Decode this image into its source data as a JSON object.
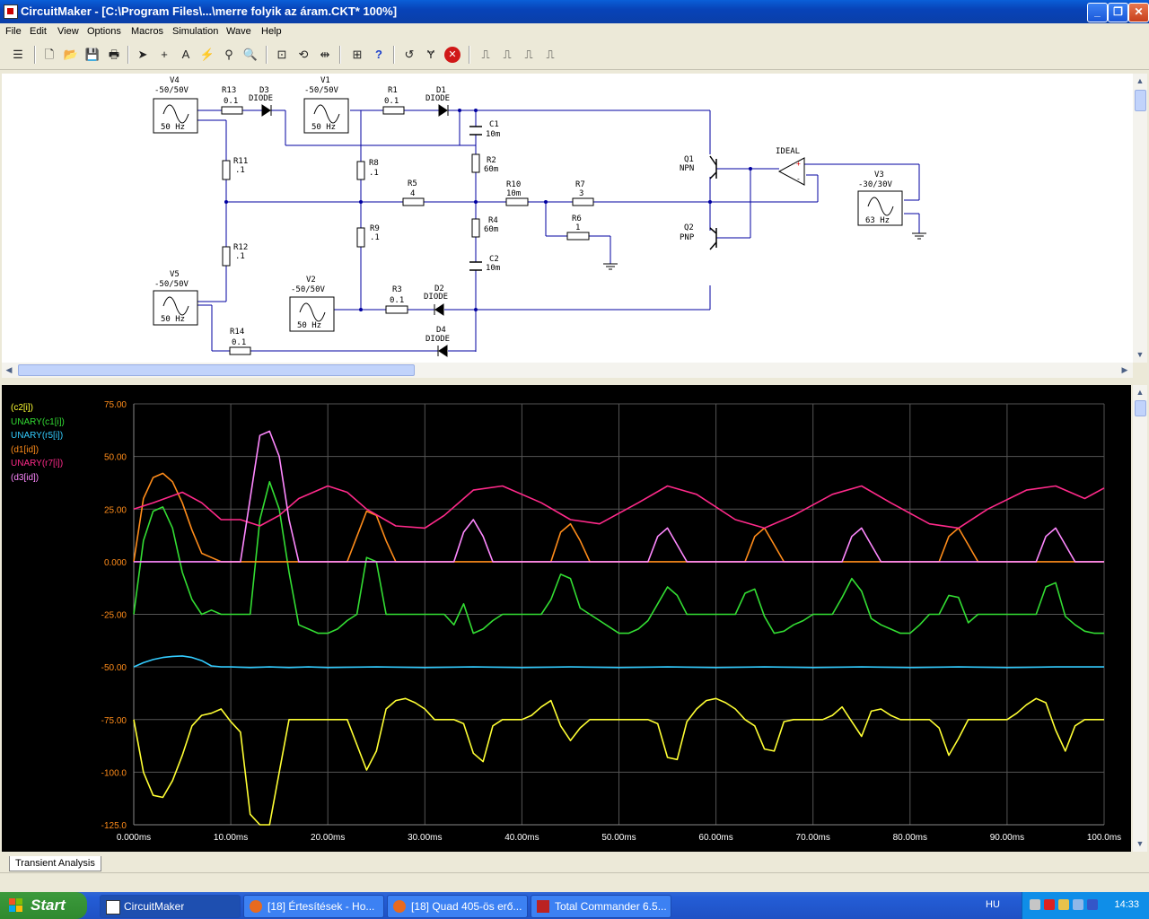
{
  "window": {
    "title": "CircuitMaker - [C:\\Program Files\\...\\merre folyik az áram.CKT* 100%]"
  },
  "menu": [
    "File",
    "Edit",
    "View",
    "Options",
    "Macros",
    "Simulation",
    "Wave",
    "Help"
  ],
  "schematic": {
    "labels": {
      "V4": "V4",
      "V4v": "-50/50V",
      "V4f": "50 Hz",
      "V1": "V1",
      "V1v": "-50/50V",
      "V1f": "50 Hz",
      "V5": "V5",
      "V5v": "-50/50V",
      "V5f": "50 Hz",
      "V2": "V2",
      "V2v": "-50/50V",
      "V2f": "50 Hz",
      "V3": "V3",
      "V3v": "-30/30V",
      "V3f": "63 Hz",
      "R13": "R13",
      "R13v": "0.1",
      "D3": "D3",
      "D3v": "DIODE",
      "R1": "R1",
      "R1v": "0.1",
      "D1": "D1",
      "D1v": "DIODE",
      "C1": "C1",
      "C1v": "10m",
      "R11": "R11",
      "R11v": ".1",
      "R8": "R8",
      "R8v": ".1",
      "R2": "R2",
      "R2v": "60m",
      "R5": "R5",
      "R5v": "4",
      "R10": "R10",
      "R10v": "10m",
      "R7": "R7",
      "R7v": "3",
      "R6": "R6",
      "R6v": "1",
      "R4": "R4",
      "R4v": "60m",
      "R9": "R9",
      "R9v": ".1",
      "R12": "R12",
      "R12v": ".1",
      "C2": "C2",
      "C2v": "10m",
      "R3": "R3",
      "R3v": "0.1",
      "D2": "D2",
      "D2v": "DIODE",
      "R14": "R14",
      "R14v": "0.1",
      "D4": "D4",
      "D4v": "DIODE",
      "Q1": "Q1",
      "Q1v": "NPN",
      "Q2": "Q2",
      "Q2v": "PNP",
      "IDEAL": "IDEAL"
    }
  },
  "colors": {
    "c2": "#ffff33",
    "c1": "#33dd33",
    "r5": "#33ccff",
    "d1": "#ff8c1a",
    "r7": "#ff2a8a",
    "d3": "#ff88ff",
    "axis": "#ff8c1a"
  },
  "chart_data": {
    "type": "line",
    "title": "",
    "xlabel": "",
    "ylabel": "",
    "xlim": [
      0,
      100
    ],
    "ylim": [
      -125,
      75
    ],
    "x_tick_labels": [
      "0.000ms",
      "10.00ms",
      "20.00ms",
      "30.00ms",
      "40.00ms",
      "50.00ms",
      "60.00ms",
      "70.00ms",
      "80.00ms",
      "90.00ms",
      "100.0ms"
    ],
    "y_tick_labels": [
      "75.00",
      "50.00",
      "25.00",
      "0.000",
      "-25.00",
      "-50.00",
      "-75.00",
      "-100.0",
      "-125.0"
    ],
    "y_ticks": [
      75,
      50,
      25,
      0,
      -25,
      -50,
      -75,
      -100,
      -125
    ],
    "grid": true,
    "legend_position": "top-left",
    "series": [
      {
        "name": "(c2[i])",
        "key": "c2",
        "x": [
          0,
          1,
          2,
          3,
          4,
          5,
          6,
          7,
          8,
          9,
          10,
          11,
          12,
          13,
          14,
          15,
          16,
          17,
          18,
          19,
          20,
          21,
          22,
          23,
          24,
          25,
          26,
          27,
          28,
          29,
          30,
          31,
          32,
          33,
          34,
          35,
          36,
          37,
          38,
          39,
          40,
          41,
          42,
          43,
          44,
          45,
          46,
          47,
          48,
          49,
          50,
          51,
          52,
          53,
          54,
          55,
          56,
          57,
          58,
          59,
          60,
          61,
          62,
          63,
          64,
          65,
          66,
          67,
          68,
          69,
          70,
          71,
          72,
          73,
          74,
          75,
          76,
          77,
          78,
          79,
          80,
          81,
          82,
          83,
          84,
          85,
          86,
          87,
          88,
          89,
          90,
          91,
          92,
          93,
          94,
          95,
          96,
          97,
          98,
          99,
          100
        ],
        "values": [
          -75,
          -100,
          -111,
          -112,
          -104,
          -92,
          -78,
          -73,
          -72,
          -70,
          -76,
          -81,
          -120,
          -130,
          -125,
          -100,
          -75,
          -75,
          -75,
          -75,
          -75,
          -75,
          -75,
          -87,
          -99,
          -90,
          -70,
          -66,
          -65,
          -67,
          -70,
          -75,
          -75,
          -75,
          -77,
          -91,
          -95,
          -78,
          -75,
          -75,
          -75,
          -73,
          -69,
          -66,
          -78,
          -85,
          -79,
          -75,
          -75,
          -75,
          -75,
          -75,
          -75,
          -75,
          -77,
          -93,
          -94,
          -76,
          -70,
          -66,
          -65,
          -67,
          -70,
          -75,
          -78,
          -89,
          -90,
          -76,
          -75,
          -75,
          -75,
          -75,
          -73,
          -69,
          -76,
          -83,
          -71,
          -70,
          -73,
          -75,
          -75,
          -75,
          -75,
          -79,
          -92,
          -84,
          -75,
          -75,
          -75,
          -75,
          -75,
          -72,
          -68,
          -65,
          -67,
          -80,
          -90,
          -78,
          -75,
          -75,
          -75
        ]
      },
      {
        "name": "UNARY(c1[i])",
        "key": "c1",
        "x": [
          0,
          1,
          2,
          3,
          4,
          5,
          6,
          7,
          8,
          9,
          10,
          11,
          12,
          13,
          14,
          15,
          16,
          17,
          18,
          19,
          20,
          21,
          22,
          23,
          24,
          25,
          26,
          27,
          28,
          29,
          30,
          31,
          32,
          33,
          34,
          35,
          36,
          37,
          38,
          39,
          40,
          41,
          42,
          43,
          44,
          45,
          46,
          47,
          48,
          49,
          50,
          51,
          52,
          53,
          54,
          55,
          56,
          57,
          58,
          59,
          60,
          61,
          62,
          63,
          64,
          65,
          66,
          67,
          68,
          69,
          70,
          71,
          72,
          73,
          74,
          75,
          76,
          77,
          78,
          79,
          80,
          81,
          82,
          83,
          84,
          85,
          86,
          87,
          88,
          89,
          90,
          91,
          92,
          93,
          94,
          95,
          96,
          97,
          98,
          99,
          100
        ],
        "values": [
          -25,
          10,
          24,
          26,
          16,
          -5,
          -18,
          -25,
          -23,
          -25,
          -25,
          -25,
          -25,
          20,
          38,
          25,
          -5,
          -30,
          -32,
          -34,
          -34,
          -32,
          -28,
          -25,
          2,
          0,
          -25,
          -25,
          -25,
          -25,
          -25,
          -25,
          -25,
          -30,
          -20,
          -34,
          -32,
          -28,
          -25,
          -25,
          -25,
          -25,
          -25,
          -18,
          -6,
          -8,
          -22,
          -25,
          -28,
          -31,
          -34,
          -34,
          -32,
          -28,
          -20,
          -12,
          -16,
          -25,
          -25,
          -25,
          -25,
          -25,
          -25,
          -15,
          -13,
          -26,
          -34,
          -33,
          -30,
          -28,
          -25,
          -25,
          -25,
          -17,
          -8,
          -14,
          -27,
          -30,
          -32,
          -34,
          -34,
          -30,
          -25,
          -25,
          -16,
          -17,
          -29,
          -25,
          -25,
          -25,
          -25,
          -25,
          -25,
          -25,
          -12,
          -10,
          -26,
          -30,
          -33,
          -34,
          -34
        ]
      },
      {
        "name": "UNARY(r5[i])",
        "key": "r5",
        "x": [
          0,
          1,
          2,
          3,
          4,
          5,
          6,
          7,
          8,
          9,
          10,
          12,
          14,
          16,
          18,
          20,
          25,
          30,
          35,
          40,
          45,
          50,
          55,
          60,
          65,
          70,
          75,
          80,
          85,
          90,
          95,
          100
        ],
        "values": [
          -50,
          -48,
          -46.5,
          -45.5,
          -45,
          -44.8,
          -45.5,
          -47,
          -49.5,
          -50,
          -50,
          -50.3,
          -50,
          -50.3,
          -50,
          -50.3,
          -50,
          -50.3,
          -50,
          -50.3,
          -50,
          -50.3,
          -50,
          -50.3,
          -50,
          -50.3,
          -50,
          -50.3,
          -50,
          -50.3,
          -50,
          -50
        ]
      },
      {
        "name": "(d1[id])",
        "key": "d1",
        "x": [
          0,
          1,
          2,
          3,
          4,
          5,
          6,
          7,
          8,
          9,
          10,
          22,
          23,
          24,
          25,
          26,
          27,
          43,
          44,
          45,
          46,
          47,
          63,
          64,
          65,
          66,
          67,
          83,
          84,
          85,
          86,
          87,
          100
        ],
        "values": [
          0,
          30,
          40,
          42,
          38,
          28,
          15,
          4,
          2,
          0,
          0,
          0,
          12,
          24,
          22,
          10,
          0,
          0,
          14,
          18,
          10,
          0,
          0,
          12,
          16,
          8,
          0,
          0,
          12,
          16,
          8,
          0,
          0
        ]
      },
      {
        "name": "UNARY(r7[i])",
        "key": "r7",
        "x": [
          0,
          2,
          5,
          7,
          9,
          11,
          13,
          15,
          17,
          20,
          22,
          24,
          27,
          30,
          32,
          35,
          38,
          42,
          45,
          48,
          52,
          55,
          58,
          62,
          65,
          68,
          72,
          75,
          78,
          82,
          85,
          88,
          92,
          95,
          98,
          100
        ],
        "values": [
          25,
          28,
          33,
          28,
          20,
          20,
          17,
          22,
          30,
          36,
          33,
          25,
          17,
          16,
          22,
          34,
          36,
          28,
          20,
          18,
          28,
          36,
          32,
          20,
          16,
          22,
          32,
          36,
          28,
          18,
          16,
          25,
          34,
          36,
          30,
          35
        ]
      },
      {
        "name": "(d3[id])",
        "key": "d3",
        "x": [
          0,
          11,
          12,
          13,
          14,
          15,
          16,
          17,
          33,
          34,
          35,
          36,
          37,
          53,
          54,
          55,
          56,
          57,
          73,
          74,
          75,
          76,
          77,
          93,
          94,
          95,
          96,
          97,
          100
        ],
        "values": [
          0,
          0,
          30,
          60,
          62,
          50,
          20,
          0,
          0,
          14,
          20,
          12,
          0,
          0,
          12,
          16,
          8,
          0,
          0,
          12,
          16,
          8,
          0,
          0,
          12,
          16,
          8,
          0,
          0
        ]
      }
    ]
  },
  "tabs": [
    "Transient Analysis"
  ],
  "taskbar": {
    "start": "Start",
    "tasks": [
      "CircuitMaker",
      "[18] Értesítések - Ho...",
      "[18] Quad 405-ös erő...",
      "Total Commander 6.5..."
    ],
    "lang": "HU",
    "clock": "14:33"
  }
}
